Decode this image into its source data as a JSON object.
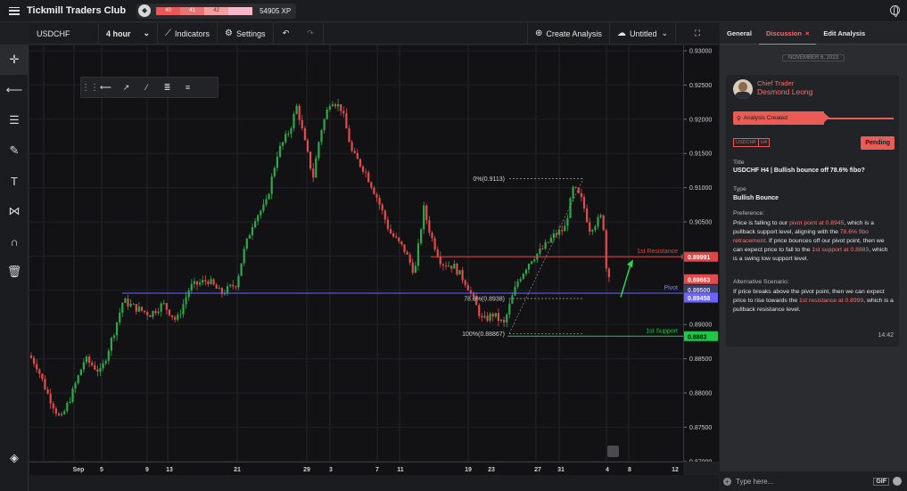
{
  "app": {
    "title": "Tickmill Traders Club",
    "xp_segments": [
      "40",
      "41",
      "42"
    ],
    "xp_value": "54905 XP"
  },
  "toolbar": {
    "symbol": "USDCHF",
    "timeframe": "4 hour",
    "indicators": "Indicators",
    "settings": "Settings",
    "create_analysis": "Create Analysis",
    "layout_name": "Untitled"
  },
  "chart": {
    "price_ticks": [
      "0.93000",
      "0.92500",
      "0.92000",
      "0.91500",
      "0.91000",
      "0.90500",
      "0.90000",
      "0.89500",
      "0.89000",
      "0.88500",
      "0.88000",
      "0.87500",
      "0.87000"
    ],
    "time_ticks": [
      "Sep",
      "5",
      "9",
      "13",
      "21",
      "29",
      "3",
      "7",
      "11",
      "19",
      "23",
      "27",
      "31",
      "4",
      "8",
      "12"
    ],
    "levels": {
      "resistance_label": "1st Resistance",
      "pivot_label": "Pivot",
      "support_label": "1st Support",
      "resistance_price": "0.89991",
      "pivot_price": "0.89458",
      "support_price": "0.8883",
      "current_price": "0.89663",
      "pivot_tick": "0.89500"
    },
    "fib": {
      "f0": "0%(0.9113)",
      "f786": "78.6%(0.8938)",
      "f100": "100%(0.88867)"
    }
  },
  "panel": {
    "tabs": [
      "General",
      "Discussion",
      "Edit Analysis"
    ],
    "date": "NOVEMBER 6, 2023",
    "role": "Chief Trader",
    "author": "Desmond Leong",
    "status_banner": "Analysis Created",
    "tags": [
      "USDCHF",
      "H4"
    ],
    "status": "Pending",
    "title_label": "Title",
    "title": "USDCHF H4 | Bullish bounce off 78.6% fibo?",
    "type_label": "Type",
    "type": "Bullish Bounce",
    "preference_label": "Preference:",
    "preference": {
      "p1": "Price is falling to our ",
      "h1": "pivot point at 0.8945",
      "p2": ", which is a pullback support level, aligning with the ",
      "h2": "78.6% fibo retracement",
      "p3": ". If price bounces off our pivot point, then we can expect price to fall to the ",
      "h3": "1st support at 0.8883",
      "p4": ", which is a swing low support level."
    },
    "alt_label": "Alternative Scenario:",
    "alternative": {
      "p1": "If price breaks above the pivot point, then we can expect price to rise towards the ",
      "h1": "1st resistance at 0.8999",
      "p2": ", which is a pullback resistance level."
    },
    "time": "14:42",
    "composer_placeholder": "Type here...",
    "gif": "GIF"
  },
  "colors": {
    "up": "#2ea84a",
    "down": "#e24b4b",
    "resistance": "#e04545",
    "pivot": "#6a64ff",
    "support": "#22c44a",
    "accent": "#ea5b55"
  }
}
